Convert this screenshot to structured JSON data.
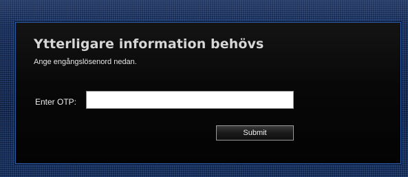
{
  "dialog": {
    "title": "Ytterligare information behövs",
    "subtitle": "Ange engångslösenord nedan.",
    "otp_label": "Enter OTP:",
    "otp_value": "",
    "submit_label": "Submit"
  },
  "colors": {
    "frame_background": "#0f1d3a",
    "panel_background": "#080808",
    "panel_border": "#2f5fa8",
    "title_text": "#d6d6d6",
    "body_text": "#ededed"
  }
}
